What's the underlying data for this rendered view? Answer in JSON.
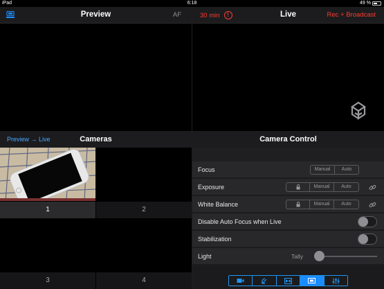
{
  "status_bar": {
    "device": "iPad",
    "time": "6:18",
    "battery": "49 %"
  },
  "preview": {
    "title": "Preview",
    "af_label": "AF",
    "device_icon": "device-settings-icon"
  },
  "live": {
    "title": "Live",
    "timer": "30 min",
    "warning_glyph": "!",
    "mode": "Rec + Broadcast",
    "logo": "switcher-logo-icon"
  },
  "cameras": {
    "link_label": "Preview → Live",
    "title": "Cameras",
    "cells": [
      {
        "label": "1",
        "selected": true
      },
      {
        "label": "2",
        "selected": false
      },
      {
        "label": "3",
        "selected": false
      },
      {
        "label": "4",
        "selected": false
      }
    ]
  },
  "camera_control": {
    "title": "Camera Control",
    "focus": {
      "label": "Focus",
      "options": [
        "Manual",
        "Auto"
      ]
    },
    "exposure": {
      "label": "Exposure",
      "options": [
        "Manual",
        "Auto"
      ]
    },
    "white_balance": {
      "label": "White Balance",
      "options": [
        "Manual",
        "Auto"
      ]
    },
    "disable_af": {
      "label": "Disable Auto Focus when Live",
      "on": false
    },
    "stabilization": {
      "label": "Stabilization",
      "on": false
    },
    "light": {
      "label": "Light",
      "tally_label": "Tally",
      "level": 0
    }
  },
  "toolbar": {
    "buttons": [
      {
        "icon": "video-camera-icon",
        "active": false
      },
      {
        "icon": "satellite-icon",
        "active": false
      },
      {
        "icon": "transition-icon",
        "active": false
      },
      {
        "icon": "screen-icon",
        "active": true
      },
      {
        "icon": "mixer-sliders-icon",
        "active": false
      }
    ]
  },
  "colors": {
    "accent_blue": "#2196f3",
    "live_red": "#ff3b30",
    "link_blue": "#4aa8ff"
  }
}
